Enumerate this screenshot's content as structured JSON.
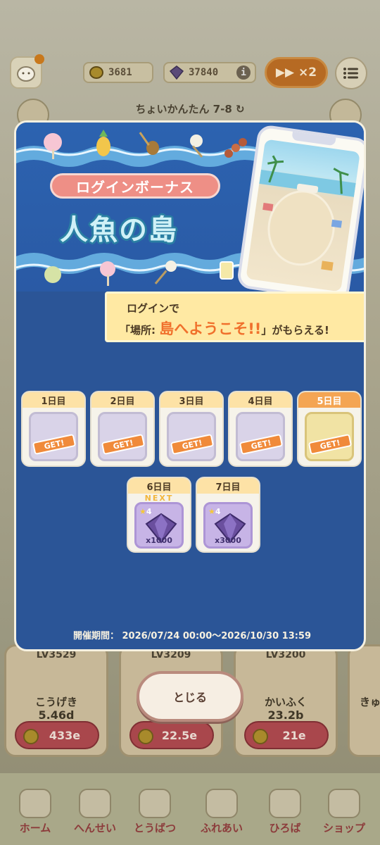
{
  "colors": {
    "modal_bg": "#2b5597",
    "info_bar": "#ffe9a3",
    "highlight_text": "#f0702c",
    "get_stamp": "#f08a3a"
  },
  "topbar": {
    "coins": "3681",
    "gems": "37840",
    "info_icon": "i",
    "speed": "▶▶ ×2",
    "icons": [
      "avatar-icon",
      "coin-icon",
      "gem-icon",
      "info-icon",
      "menu-icon"
    ]
  },
  "stage": {
    "label": "ちょいかんたん 7-8 ↻"
  },
  "units": [
    {
      "level": "LV3529",
      "name": "こうげき",
      "value": "5.46d",
      "cost": "433e"
    },
    {
      "level": "LV3209",
      "name": "",
      "value": "",
      "cost": "22.5e"
    },
    {
      "level": "LV3200",
      "name": "かいふく",
      "value": "23.2b",
      "cost": "21e"
    },
    {
      "level": "",
      "name": "きゅ",
      "value": "",
      "cost": ""
    }
  ],
  "bottom_nav": [
    {
      "label": "ホーム",
      "icon": "home-icon"
    },
    {
      "label": "へんせい",
      "icon": "team-icon"
    },
    {
      "label": "とうばつ",
      "icon": "battle-icon"
    },
    {
      "label": "ふれあい",
      "icon": "interact-icon"
    },
    {
      "label": "ひろば",
      "icon": "plaza-icon"
    },
    {
      "label": "ショップ",
      "icon": "shop-icon"
    }
  ],
  "modal": {
    "banner_pill": "ログインボーナス",
    "island_title": "人魚の島",
    "info_line1": "ログインで",
    "info_line2_prefix": "「場所: ",
    "info_line2_highlight": "島へようこそ!!",
    "info_line2_suffix": "」がもらえる!",
    "days": [
      {
        "label": "1日目",
        "stamp": "GET!",
        "reward": "stamp"
      },
      {
        "label": "2日目",
        "stamp": "GET!",
        "reward": "stamp"
      },
      {
        "label": "3日目",
        "stamp": "GET!",
        "reward": "stamp"
      },
      {
        "label": "4日目",
        "stamp": "GET!",
        "reward": "stamp"
      },
      {
        "label": "5日目",
        "stamp": "GET!",
        "reward": "stamp-gold"
      },
      {
        "label": "6日目",
        "next": "NEXT",
        "stars": "4",
        "qty": "x1000",
        "reward": "gem"
      },
      {
        "label": "7日目",
        "stars": "4",
        "qty": "x3000",
        "reward": "gem"
      }
    ],
    "period": "開催期間： 2026/07/24 00:00〜2026/10/30 13:59"
  },
  "close_button": "とじる"
}
